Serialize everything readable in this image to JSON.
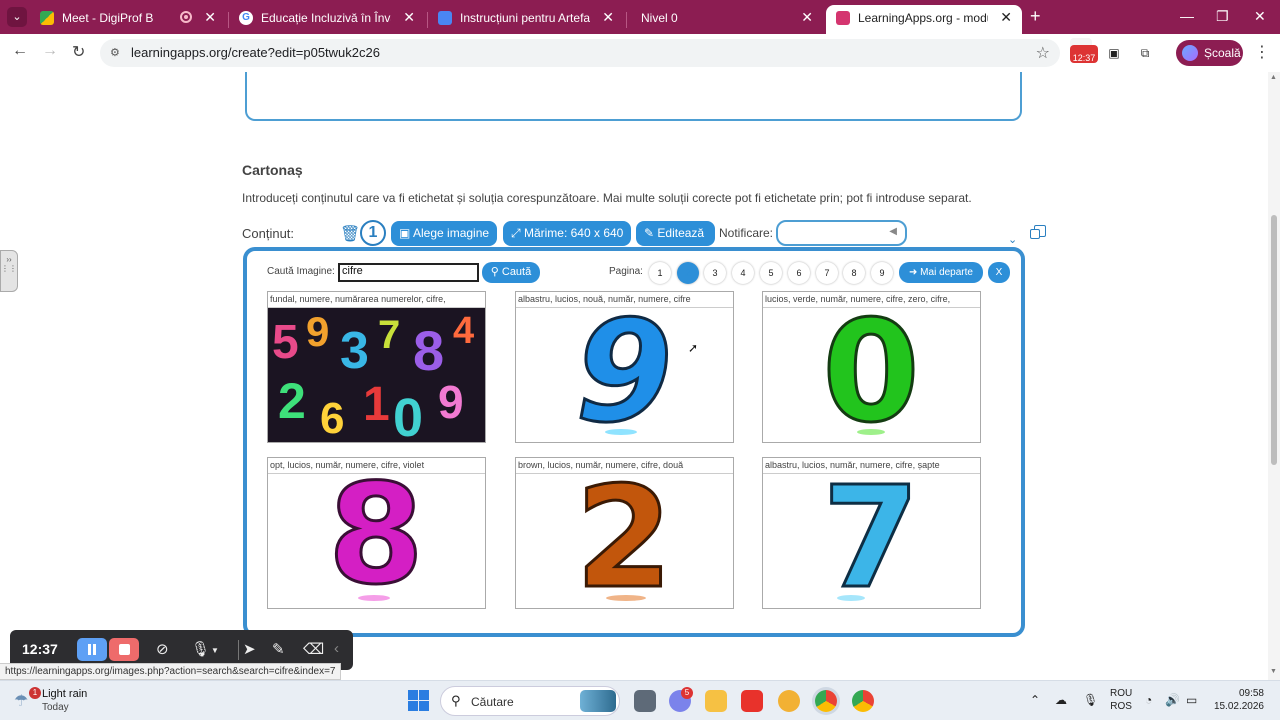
{
  "browser": {
    "tabs": [
      {
        "label": "Meet - DigiProf B",
        "favicon": "meet-icon",
        "recording": true
      },
      {
        "label": "Educație Incluzivă în Învățarea D",
        "favicon": "google-icon"
      },
      {
        "label": "Instrucțiuni pentru Artefactele s",
        "favicon": "docs-icon"
      },
      {
        "label": "Nivel 0",
        "favicon": "none"
      },
      {
        "label": "LearningApps.org - module de",
        "favicon": "learningapps-icon",
        "active": true
      }
    ],
    "url": "learningapps.org/create?edit=p05twuk2c26",
    "extension_badge": "12:37",
    "profile_label": "Școală"
  },
  "editor": {
    "section_title": "Cartonaș",
    "section_desc": "Introduceți conținutul care va fi etichetat și soluția corespunzătoare. Mai multe soluții corecte pot fi etichetate prin; pot fi introduse separat.",
    "content_label": "Conținut:",
    "item_number": "1",
    "btn_choose_image": "Alege imagine",
    "btn_size": "Mărime: 640 x 640",
    "btn_edit": "Editează",
    "notification_label": "Notificare:"
  },
  "image_search": {
    "search_label": "Caută Imagine:",
    "search_value": "cifre",
    "search_button": "Caută",
    "page_label": "Pagina:",
    "pages": [
      "1",
      "2",
      "3",
      "4",
      "5",
      "6",
      "7",
      "8",
      "9"
    ],
    "active_page": "2",
    "more_button": "Mai departe",
    "close_button": "X",
    "results": [
      {
        "caption": "fundal, numere, numărarea numerelor, cifre,",
        "kind": "mosaic"
      },
      {
        "caption": "albastru, lucios, nouă, număr, numere, cifre",
        "digit": "9",
        "color": "#1f8fe8"
      },
      {
        "caption": "lucios, verde, număr, numere, cifre, zero, cifre,",
        "digit": "0",
        "color": "#22c41d"
      },
      {
        "caption": "opt, lucios, număr, numere, cifre, violet",
        "digit": "8",
        "color": "#d41fc4"
      },
      {
        "caption": "brown, lucios, număr, numere, cifre, două",
        "digit": "2",
        "color": "#c2560c"
      },
      {
        "caption": "albastru, lucios, număr, numere, cifre, șapte",
        "digit": "7",
        "color": "#3cb5e8"
      }
    ]
  },
  "recorder": {
    "time": "12:37"
  },
  "status_url": "https://learningapps.org/images.php?action=search&search=cifre&index=7",
  "taskbar": {
    "weather_title": "Light rain",
    "weather_sub": "Today",
    "weather_badge": "1",
    "search_placeholder": "Căutare",
    "teams_badge": "5",
    "lang_line1": "ROU",
    "lang_line2": "ROS",
    "time": "09:58",
    "date": "15.02.2026"
  }
}
